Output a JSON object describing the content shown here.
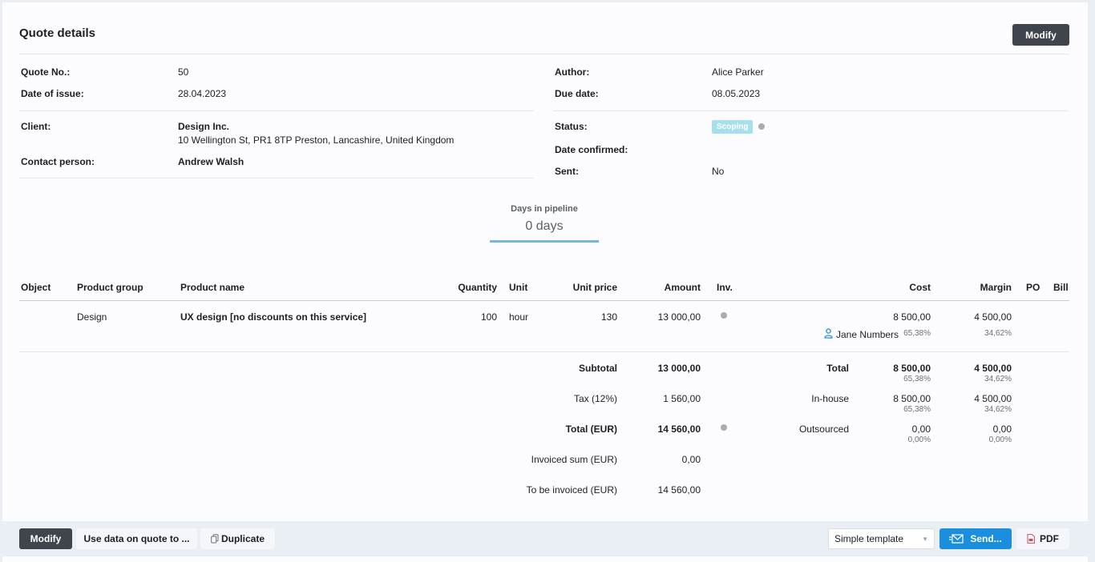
{
  "header": {
    "title": "Quote details",
    "modify_label": "Modify"
  },
  "info": {
    "quote_no_label": "Quote No.:",
    "quote_no": "50",
    "date_issue_label": "Date of issue:",
    "date_issue": "28.04.2023",
    "client_label": "Client:",
    "client_name": "Design Inc.",
    "client_address": "10 Wellington St, PR1 8TP Preston, Lancashire, United Kingdom",
    "contact_label": "Contact person:",
    "contact": "Andrew Walsh",
    "author_label": "Author:",
    "author": "Alice Parker",
    "due_label": "Due date:",
    "due": "08.05.2023",
    "status_label": "Status:",
    "status": "Scoping",
    "confirmed_label": "Date confirmed:",
    "confirmed": "",
    "sent_label": "Sent:",
    "sent": "No"
  },
  "pipeline": {
    "label": "Days in pipeline",
    "value": "0 days"
  },
  "table": {
    "headers": [
      "Object",
      "Product group",
      "Product name",
      "Quantity",
      "Unit",
      "Unit price",
      "Amount",
      "Inv.",
      "Cost",
      "Margin",
      "PO",
      "Bill"
    ],
    "row": {
      "object": "",
      "group": "Design",
      "name": "UX design [no discounts on this service]",
      "quantity": "100",
      "unit": "hour",
      "unit_price": "130",
      "amount": "13 000,00",
      "cost": "8 500,00",
      "cost_pct": "65,38%",
      "margin": "4 500,00",
      "margin_pct": "34,62%",
      "person": "Jane Numbers"
    }
  },
  "summary": {
    "subtotal_label": "Subtotal",
    "subtotal": "13 000,00",
    "tax_label": "Tax (12%)",
    "tax": "1 560,00",
    "total_label": "Total (EUR)",
    "total": "14 560,00",
    "invoiced_label": "Invoiced sum (EUR)",
    "invoiced": "0,00",
    "tobe_label": "To be invoiced (EUR)",
    "tobe": "14 560,00",
    "right": {
      "total_label": "Total",
      "total_cost": "8 500,00",
      "total_cost_pct": "65,38%",
      "total_margin": "4 500,00",
      "total_margin_pct": "34,62%",
      "inhouse_label": "In-house",
      "inhouse_cost": "8 500,00",
      "inhouse_cost_pct": "65,38%",
      "inhouse_margin": "4 500,00",
      "inhouse_margin_pct": "34,62%",
      "out_label": "Outsourced",
      "out_cost": "0,00",
      "out_cost_pct": "0,00%",
      "out_margin": "0,00",
      "out_margin_pct": "0,00%"
    }
  },
  "footer": {
    "modify_label": "Modify",
    "use_data_label": "Use data on quote to ...",
    "duplicate_label": "Duplicate",
    "template_value": "Simple template",
    "send_label": "Send...",
    "pdf_label": "PDF"
  },
  "colors": {
    "accent": "#1b8fde",
    "dark_button": "#40444d",
    "badge": "#a7e0ec",
    "pipeline_line": "#7ab6da"
  }
}
